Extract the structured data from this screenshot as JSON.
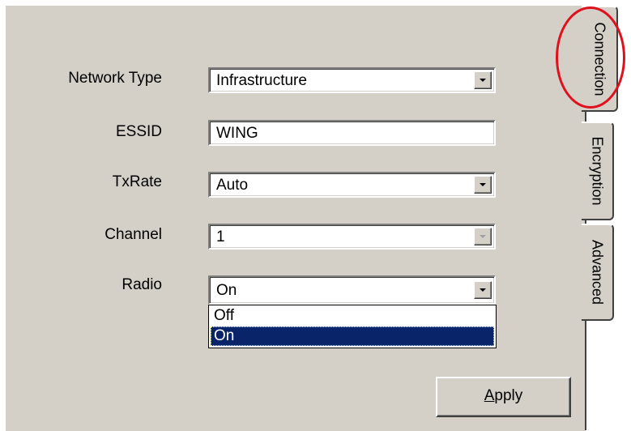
{
  "form": {
    "network_type": {
      "label": "Network Type",
      "value": "Infrastructure"
    },
    "essid": {
      "label": "ESSID",
      "value": "WING"
    },
    "txrate": {
      "label": "TxRate",
      "value": "Auto"
    },
    "channel": {
      "label": "Channel",
      "value": "1"
    },
    "radio": {
      "label": "Radio",
      "value": "On",
      "options": [
        "Off",
        "On"
      ],
      "selected_index": 1
    }
  },
  "tabs": [
    {
      "label": "Connection",
      "active": true
    },
    {
      "label": "Encryption",
      "active": false
    },
    {
      "label": "Advanced",
      "active": false
    }
  ],
  "apply_button": {
    "label_prefix": "A",
    "label_rest": "pply"
  },
  "colors": {
    "highlight": "#0a246a",
    "callout": "#e0101c",
    "face": "#d4d0c8"
  }
}
